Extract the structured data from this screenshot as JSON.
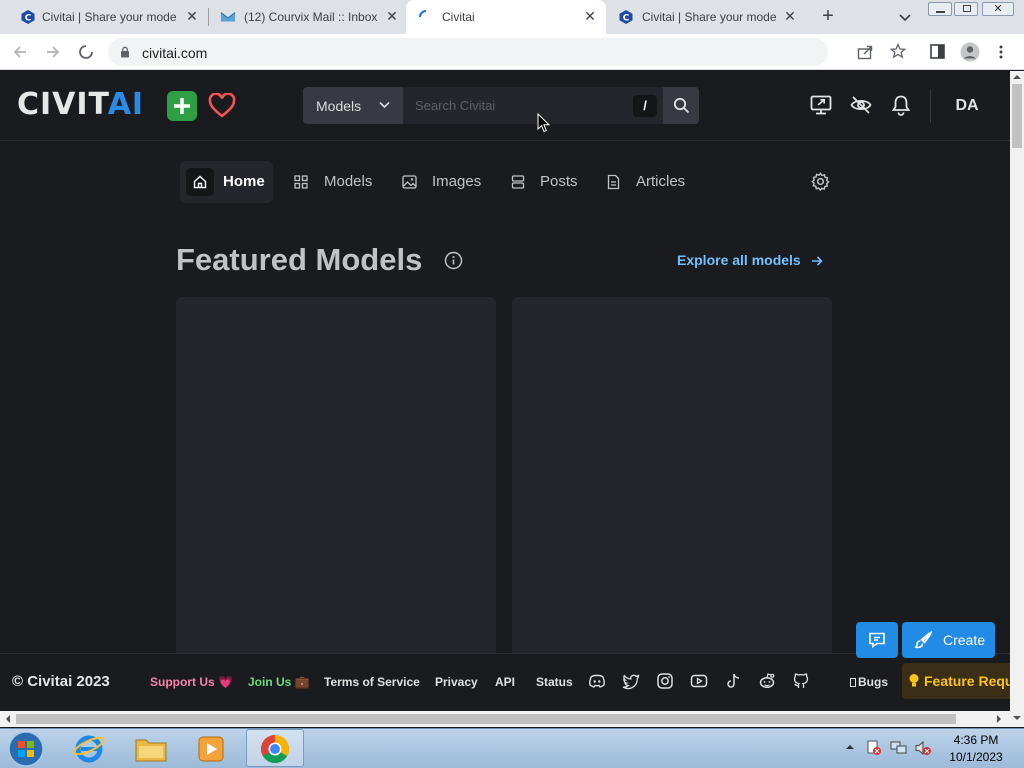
{
  "browser": {
    "tabs": [
      {
        "title": "Civitai | Share your models",
        "active": false
      },
      {
        "title": "(12) Courvix Mail :: Inbox",
        "active": false
      },
      {
        "title": "Civitai",
        "active": true
      },
      {
        "title": "Civitai | Share your models",
        "active": false
      }
    ],
    "url": "civitai.com"
  },
  "header": {
    "logo_main": "CIVIT",
    "logo_accent": "AI",
    "search_type": "Models",
    "search_placeholder": "Search Civitai",
    "slash_key": "/",
    "avatar_initials": "DA"
  },
  "nav": {
    "items": [
      {
        "label": "Home",
        "icon": "home-icon"
      },
      {
        "label": "Models",
        "icon": "grid-icon"
      },
      {
        "label": "Images",
        "icon": "photo-icon"
      },
      {
        "label": "Posts",
        "icon": "posts-icon"
      },
      {
        "label": "Articles",
        "icon": "article-icon"
      }
    ]
  },
  "featured": {
    "title": "Featured Models",
    "explore_label": "Explore all models"
  },
  "floating": {
    "create_label": "Create"
  },
  "footer": {
    "copyright": "© Civitai 2023",
    "support": "Support Us 💗",
    "join": "Join Us 💼",
    "terms": "Terms of Service",
    "privacy": "Privacy",
    "api": "API",
    "status": "Status",
    "bugs": "Bugs",
    "feature_request": "Feature Requ"
  },
  "taskbar": {
    "time": "4:36 PM",
    "date": "10/1/2023"
  },
  "colors": {
    "accent_blue": "#228be6",
    "plus_green": "#2f9e44",
    "heart_red": "#fa5252",
    "link_blue": "#74c0fc"
  }
}
